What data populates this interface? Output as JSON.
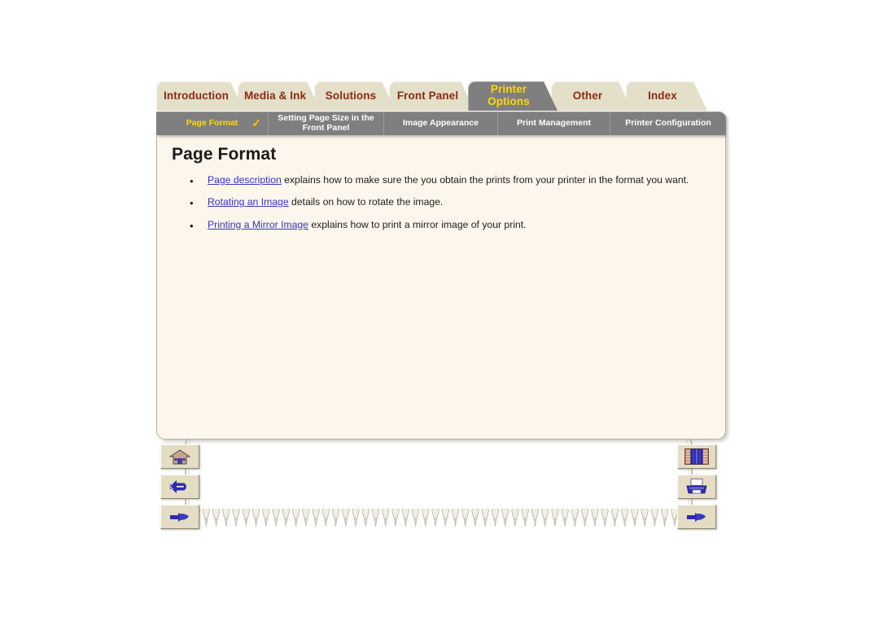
{
  "app": {
    "document_title": "Page Format"
  },
  "tabs": [
    {
      "label": "Introduction",
      "active": false,
      "name": "tab-introduction"
    },
    {
      "label": "Media & Ink",
      "active": false,
      "name": "tab-media-and-ink"
    },
    {
      "label": "Solutions",
      "active": false,
      "name": "tab-solutions"
    },
    {
      "label": "Front Panel",
      "active": false,
      "name": "tab-front-panel"
    },
    {
      "label": "Printer Options",
      "active": true,
      "name": "tab-printer-options"
    },
    {
      "label": "Other",
      "active": false,
      "name": "tab-other"
    },
    {
      "label": "Index",
      "active": false,
      "name": "tab-index"
    }
  ],
  "subnav": {
    "items": [
      {
        "label": "Page Format",
        "current": true,
        "check": "✓"
      },
      {
        "label": "Setting Page Size in the Front Panel",
        "current": false
      },
      {
        "label": "Image Appearance",
        "current": false
      },
      {
        "label": "Print Management",
        "current": false
      },
      {
        "label": "Printer Configuration",
        "current": false
      }
    ]
  },
  "content": {
    "title": "Page Format",
    "bullets": [
      {
        "bullet": "•",
        "link": "Page description",
        "text": " explains how to make sure the you obtain the prints from your printer in the format you want."
      },
      {
        "bullet": "•",
        "link": "Rotating an Image",
        "text": " details on how to rotate the image."
      },
      {
        "bullet": "•",
        "link": "Printing a Mirror Image",
        "text": " explains how to print a mirror image of your print."
      }
    ]
  },
  "buttons": {
    "left": [
      {
        "icon": "home-icon",
        "name": "home-button"
      },
      {
        "icon": "back-arrow-icon",
        "name": "back-button"
      },
      {
        "icon": "pointing-hand-icon",
        "name": "next-button"
      }
    ],
    "right": [
      {
        "icon": "bookshelf-icon",
        "name": "library-button"
      },
      {
        "icon": "printer-icon",
        "name": "print-button"
      },
      {
        "icon": "pointing-hand-icon",
        "name": "forward-button"
      }
    ]
  },
  "colors": {
    "tab_face": "#E4DFC9",
    "tab_text": "#8C2A15",
    "active_tab_face": "#7F7F7F",
    "active_tab_text": "#FFD800",
    "page_background": "#FDF6EC",
    "link": "#3333CC",
    "subnav_background": "#7F7F7F",
    "button_face": "#E4DDC4"
  }
}
